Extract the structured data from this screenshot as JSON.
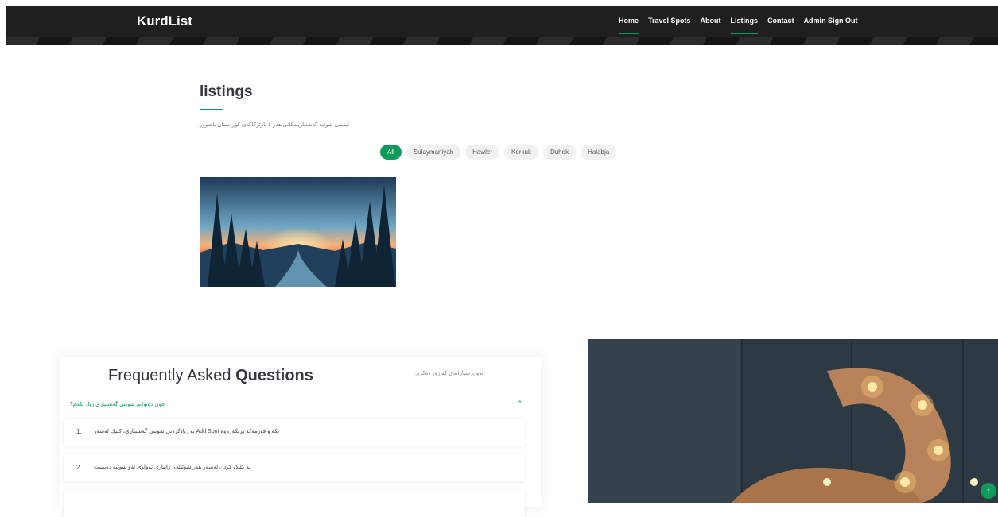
{
  "header": {
    "logo": "KurdList",
    "nav": [
      {
        "label": "Home",
        "active": true
      },
      {
        "label": "Travel Spots",
        "active": false
      },
      {
        "label": "About",
        "active": false
      },
      {
        "label": "Listings",
        "active": true
      },
      {
        "label": "Contact",
        "active": false
      },
      {
        "label": "Admin Sign Out",
        "active": false
      }
    ]
  },
  "listings": {
    "title": "listings",
    "subtitle": "لیستی شوێنە گەشتیارییەکانی هەر ٥ پارێزگاکەی کوردستان باشوور",
    "filters": [
      "All",
      "Sulaymaniyah",
      "Hawler",
      "Kerkuk",
      "Duhok",
      "Halabja"
    ],
    "active_filter": "All"
  },
  "faq": {
    "title_plain": "Frequently Asked ",
    "title_bold": "Questions",
    "side_text": "ئەو پرسیارانەی کە زۆر دەکرێن",
    "question": "چۆن دەتوانم شوێنی گەشتیاری زیاد بکەم؟",
    "answers": [
      {
        "num": "1.",
        "text": "بۆ زیادکردنی شوێنی گەشتیاری، کلیک لەسەر Add Spot بکە و فۆرمەکە پڕبکەرەوە"
      },
      {
        "num": "2.",
        "text": "بە کلیک کردن لەسەر هەر شوێنێک، زانیاری تەواوی ئەو شوێنە دەبینیت"
      }
    ]
  },
  "accent_color": "#0e9a5a"
}
